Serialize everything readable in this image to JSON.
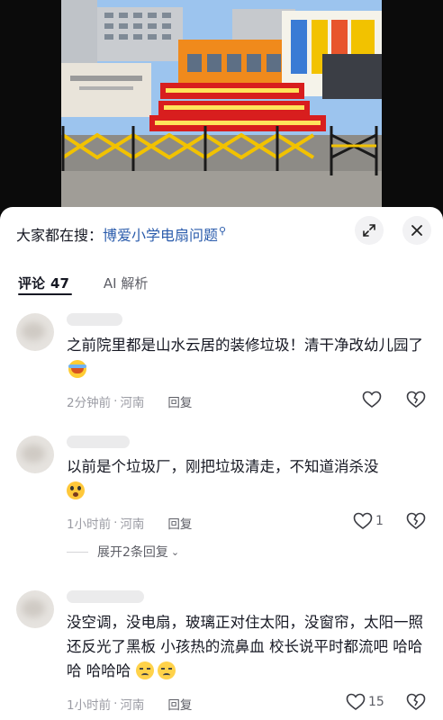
{
  "search": {
    "prefix": "大家都在搜：",
    "query": "博爱小学电扇问题",
    "search_mark": "⚲"
  },
  "tabs": {
    "comments_label": "评论",
    "comments_count": "47",
    "ai_label": "AI 解析"
  },
  "comments": [
    {
      "text": "之前院里都是山水云居的装修垃圾！清干净改幼儿园了",
      "emoji": "crying-emoji",
      "time": "2分钟前",
      "location": "河南",
      "reply_label": "回复",
      "likes": ""
    },
    {
      "text": "以前是个垃圾厂，刚把垃圾清走，不知道消杀没",
      "emoji": "surprised-emoji",
      "time": "1小时前",
      "location": "河南",
      "reply_label": "回复",
      "likes": "1",
      "expand_label": "展开2条回复"
    },
    {
      "text": "没空调，没电扇，玻璃正对住太阳，没窗帘，太阳一照还反光了黑板 小孩热的流鼻血 校长说平时都流吧 哈哈哈 哈哈哈",
      "emoji": "sad-emoji",
      "time": "1小时前",
      "location": "河南",
      "reply_label": "回复",
      "likes": "15"
    }
  ],
  "meta_separator": "·",
  "colors": {
    "link_blue": "#2b5cac",
    "banner_red": "#d81e1e",
    "barrier_yellow": "#f2c200",
    "school_orange": "#f08a1c"
  }
}
